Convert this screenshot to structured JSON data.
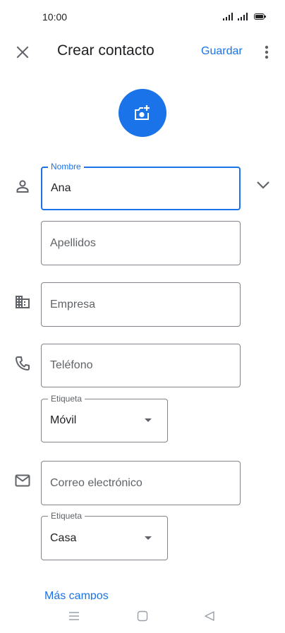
{
  "status_bar": {
    "time": "10:00"
  },
  "header": {
    "title": "Crear contacto",
    "save_label": "Guardar"
  },
  "form": {
    "nombre": {
      "label": "Nombre",
      "value": "Ana"
    },
    "apellidos": {
      "placeholder": "Apellidos"
    },
    "empresa": {
      "placeholder": "Empresa"
    },
    "telefono": {
      "placeholder": "Teléfono"
    },
    "telefono_etiqueta": {
      "label": "Etiqueta",
      "value": "Móvil"
    },
    "correo": {
      "placeholder": "Correo electrónico"
    },
    "correo_etiqueta": {
      "label": "Etiqueta",
      "value": "Casa"
    }
  },
  "more_fields_label": "Más campos",
  "colors": {
    "accent": "#1a73e8",
    "outline": "#80868b",
    "icon": "#5f6368"
  },
  "icons": [
    "close-icon",
    "more-vert-icon",
    "add-photo-icon",
    "person-icon",
    "expand-more-icon",
    "business-icon",
    "phone-icon",
    "email-icon",
    "nav-menu-icon",
    "nav-home-icon",
    "nav-back-icon"
  ]
}
